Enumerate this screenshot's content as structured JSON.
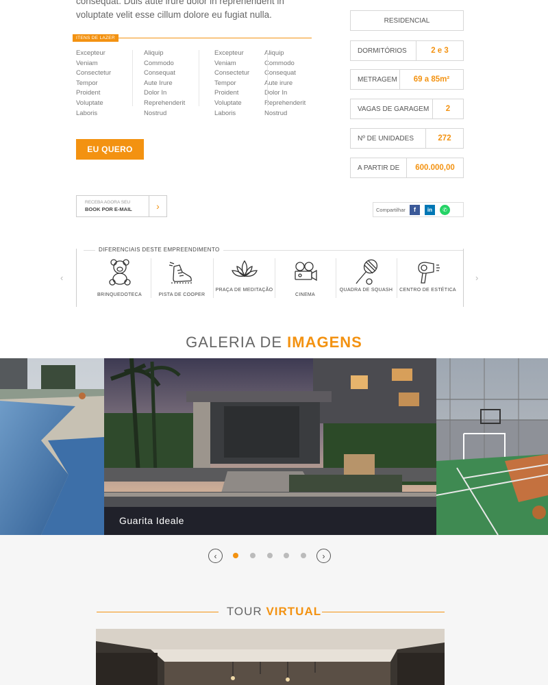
{
  "intro": {
    "text": "consequat. Duis aute irure dolor in reprehenderit in voluptate velit esse cillum dolore eu fugiat nulla."
  },
  "lazer": {
    "tag": "Itens de lazer",
    "columns": [
      [
        "Excepteur",
        "Veniam",
        "Consectetur",
        "Tempor",
        "Proident",
        "Voluptate",
        "Laboris"
      ],
      [
        "Aliquip",
        "Commodo",
        "Consequat",
        "Aute Irure",
        "Dolor In",
        "Reprehenderit",
        "Nostrud"
      ],
      [
        "Excepteur",
        "Veniam",
        "Consectetur",
        "Tempor",
        "Proident",
        "Voluptate",
        "Laboris"
      ],
      [
        "Aliquip",
        "Commodo",
        "Consequat",
        "Aute irure",
        "Dolor In",
        "Reprehenderit",
        "Nostrud"
      ]
    ]
  },
  "cta": {
    "label": "EU QUERO"
  },
  "book": {
    "line1": "Receba agora seu",
    "line2": "Book por e-mail",
    "arrow": "›"
  },
  "specs": {
    "type": "RESIDENCIAL",
    "rows": [
      {
        "label": "DORMITÓRIOS",
        "value": "2 e 3"
      },
      {
        "label": "METRAGEM",
        "value": "69 a 85m²"
      },
      {
        "label": "VAGAS DE GARAGEM",
        "value": "2"
      },
      {
        "label": "Nº DE UNIDADES",
        "value": "272"
      },
      {
        "label": "A PARTIR DE",
        "value": "600.000,00"
      }
    ]
  },
  "share": {
    "label": "Compartilhar",
    "icons": [
      "facebook-icon",
      "linkedin-icon",
      "whatsapp-icon"
    ]
  },
  "diferenciais": {
    "title": "Diferenciais deste empreendimento",
    "items": [
      {
        "icon": "teddy-bear-icon",
        "label": "Brinquedoteca"
      },
      {
        "icon": "running-shoe-icon",
        "label": "Pista de cooper"
      },
      {
        "icon": "lotus-icon",
        "label": "Praça de meditação"
      },
      {
        "icon": "movie-camera-icon",
        "label": "Cinema"
      },
      {
        "icon": "tennis-racket-icon",
        "label": "Quadra de squash"
      },
      {
        "icon": "hair-dryer-icon",
        "label": "Centro de estética"
      }
    ],
    "prev": "‹",
    "next": "›"
  },
  "gallery": {
    "title_plain": "GALERIA DE",
    "title_accent": "IMAGENS",
    "caption": "Guarita Ideale",
    "prev": "‹",
    "next": "›",
    "dots": 5,
    "active_dot": 0
  },
  "tour": {
    "title_plain": "TOUR",
    "title_accent": "VIRTUAL"
  },
  "colors": {
    "accent": "#f39211",
    "text": "#555555",
    "border": "#d6d6d6"
  }
}
